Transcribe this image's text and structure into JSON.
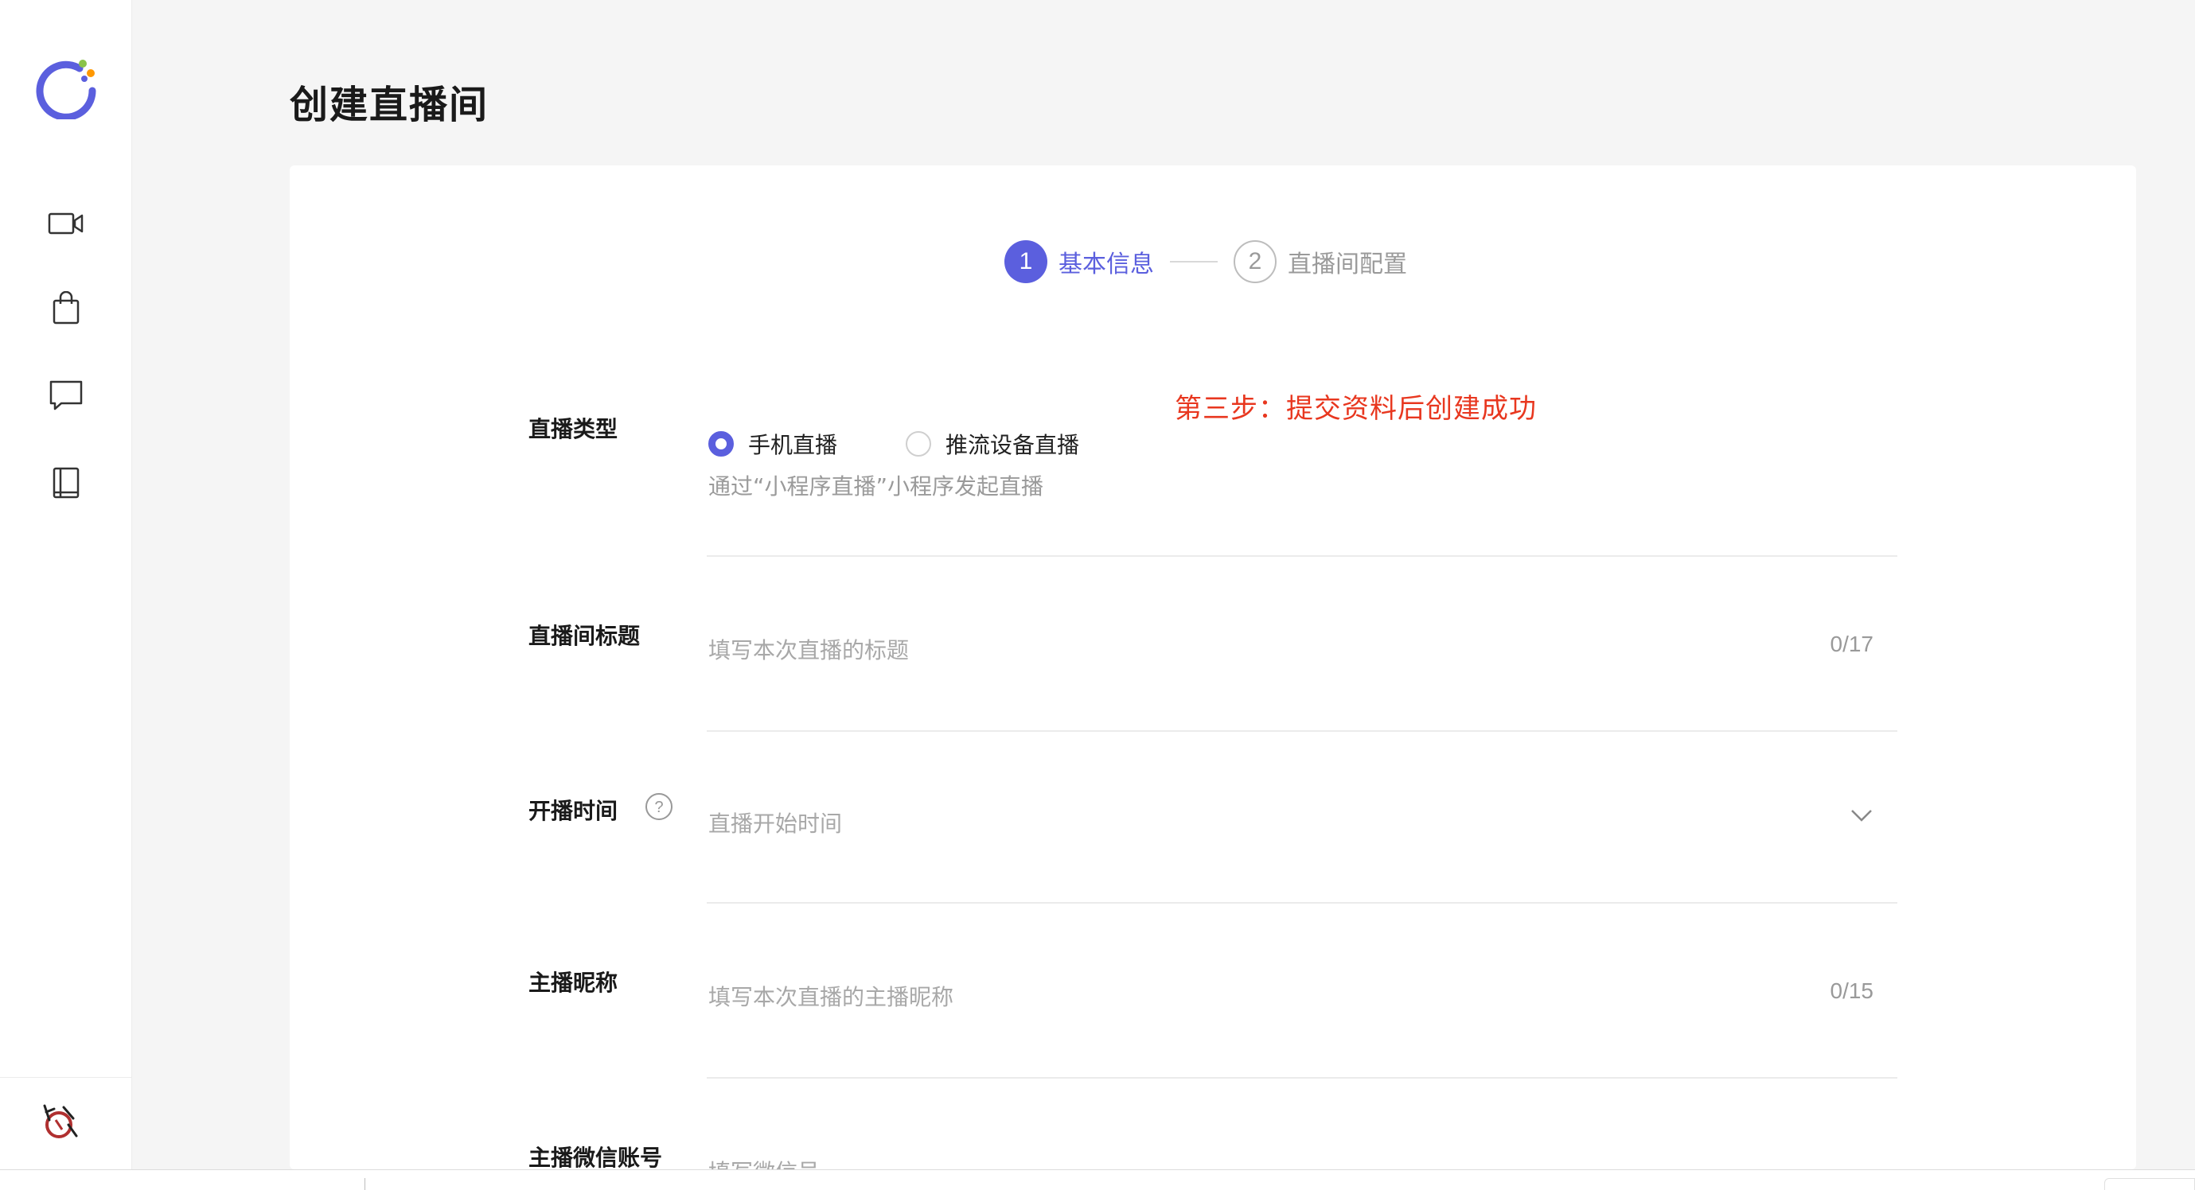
{
  "page": {
    "title": "创建直播间"
  },
  "sidebar": {
    "items": [
      {
        "icon": "video-camera-icon"
      },
      {
        "icon": "shopping-bag-icon"
      },
      {
        "icon": "message-icon"
      },
      {
        "icon": "book-icon"
      }
    ]
  },
  "steps": [
    {
      "number": "1",
      "label": "基本信息",
      "state": "active"
    },
    {
      "number": "2",
      "label": "直播间配置",
      "state": "pending"
    }
  ],
  "annotation": "第三步：提交资料后创建成功",
  "form": {
    "live_type": {
      "label": "直播类型",
      "options": [
        {
          "label": "手机直播",
          "checked": true
        },
        {
          "label": "推流设备直播",
          "checked": false
        }
      ],
      "hint": "通过“小程序直播”小程序发起直播"
    },
    "room_title": {
      "label": "直播间标题",
      "placeholder": "填写本次直播的标题",
      "counter": "0/17"
    },
    "start_time": {
      "label": "开播时间",
      "placeholder": "直播开始时间"
    },
    "anchor_nickname": {
      "label": "主播昵称",
      "placeholder": "填写本次直播的主播昵称",
      "counter": "0/15"
    },
    "anchor_wechat": {
      "label": "主播微信账号",
      "placeholder": "填写微信号"
    }
  },
  "colors": {
    "accent": "#5b5fde",
    "annotation": "#e8371f",
    "background": "#f5f5f5"
  }
}
